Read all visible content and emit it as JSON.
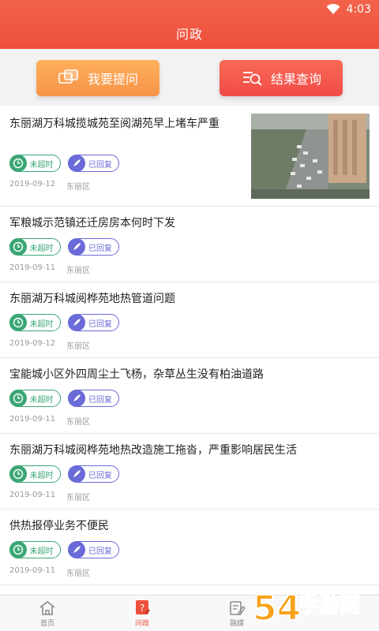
{
  "status": {
    "time": "4:03"
  },
  "header": {
    "title": "问政"
  },
  "actions": {
    "ask_label": "我要提问",
    "query_label": "结果查询"
  },
  "colors": {
    "brand": "#ee4f3c",
    "green": "#3aa676",
    "purple": "#6a6ad8",
    "orange": "#f7934a"
  },
  "items": [
    {
      "title": "东丽湖万科城揽城苑至阅湖苑早上堵车严重",
      "tag_time": "未超时",
      "tag_reply": "已回复",
      "date": "2019-09-12",
      "district": "东丽区"
    },
    {
      "title": "军粮城示范镇还迁房房本何时下发",
      "tag_time": "未超时",
      "tag_reply": "已回复",
      "date": "2019-09-11",
      "district": "东丽区"
    },
    {
      "title": "东丽湖万科城阅桦苑地热管道问题",
      "tag_time": "未超时",
      "tag_reply": "已回复",
      "date": "2019-09-12",
      "district": "东丽区"
    },
    {
      "title": "宝能城小区外四周尘土飞杨，杂草丛生没有柏油道路",
      "tag_time": "未超时",
      "tag_reply": "已回复",
      "date": "2019-09-11",
      "district": "东丽区"
    },
    {
      "title": "东丽湖万科城阅桦苑地热改造施工拖沓，严重影响居民生活",
      "tag_time": "未超时",
      "tag_reply": "已回复",
      "date": "2019-09-11",
      "district": "东丽区"
    },
    {
      "title": "供热报停业务不便民",
      "tag_time": "未超时",
      "tag_reply": "已回复",
      "date": "2019-09-11",
      "district": "东丽区"
    }
  ],
  "tabs": [
    {
      "label": "首页",
      "icon": "home-icon"
    },
    {
      "label": "问政",
      "icon": "question-icon"
    },
    {
      "label": "融媒",
      "icon": "edit-icon"
    }
  ],
  "watermark": {
    "text": "手游网",
    "number": "54"
  }
}
